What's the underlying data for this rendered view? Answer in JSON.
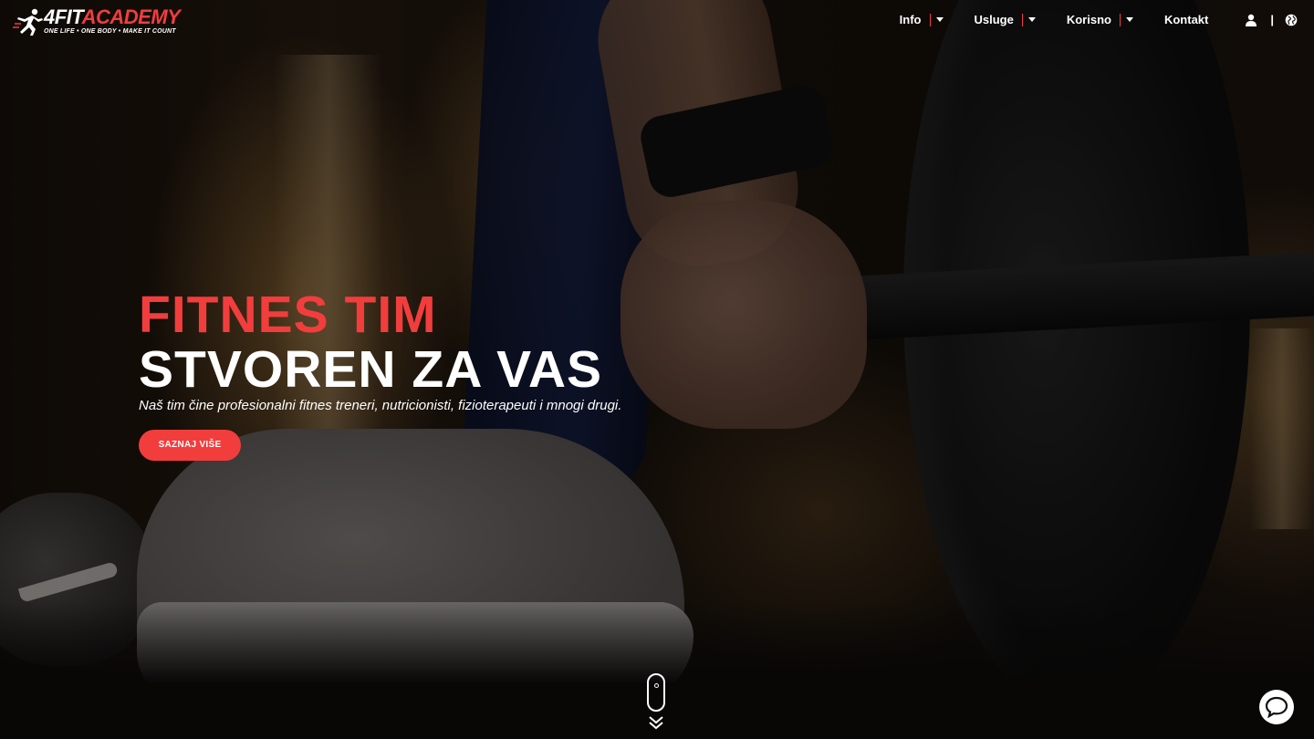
{
  "brand": {
    "name_part1": "4FIT",
    "name_part2": "ACADEMY",
    "slogan": "ONE LIFE • ONE BODY • MAKE IT COUNT",
    "accent_color": "#f23d3d"
  },
  "nav": {
    "items": [
      {
        "label": "Info",
        "has_dropdown": true
      },
      {
        "label": "Usluge",
        "has_dropdown": true
      },
      {
        "label": "Korisno",
        "has_dropdown": true
      },
      {
        "label": "Kontakt",
        "has_dropdown": false
      }
    ],
    "icons": [
      "user-icon",
      "globe-icon"
    ],
    "icon_separator": "|"
  },
  "hero": {
    "title_line1": "FITNES TIM",
    "title_line2": "STVOREN ZA VAS",
    "subtitle": "Naš tim čine profesionalni fitnes treneri, nutricionisti, fizioterapeuti i mnogi drugi.",
    "cta_label": "SAZNAJ VIŠE"
  },
  "scroll_indicator": {
    "icons": [
      "mouse-icon",
      "chevrons-down-icon"
    ]
  },
  "chat": {
    "icon": "chat-bubble-icon"
  }
}
